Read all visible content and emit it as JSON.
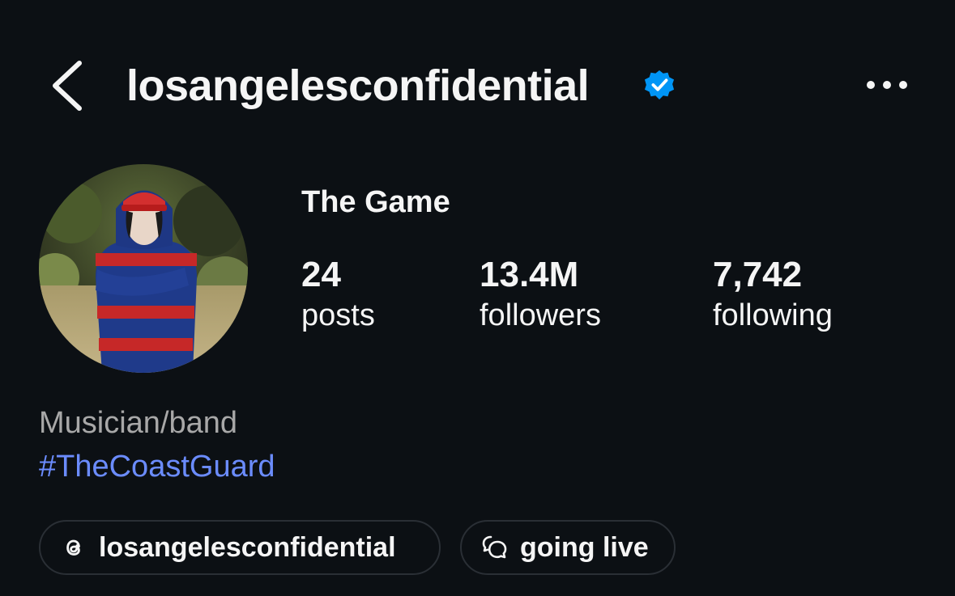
{
  "header": {
    "username": "losangelesconfidential",
    "verified": true,
    "back_icon": "chevron-left-icon",
    "more_icon": "more-horizontal-icon"
  },
  "profile": {
    "display_name": "The Game",
    "avatar": "profile-photo",
    "stats": [
      {
        "value": "24",
        "label": "posts"
      },
      {
        "value": "13.4M",
        "label": "followers"
      },
      {
        "value": "7,742",
        "label": "following"
      }
    ],
    "category": "Musician/band",
    "hashtag": "#TheCoastGuard"
  },
  "chips": {
    "threads": {
      "icon": "threads-icon",
      "label": "losangelesconfidential"
    },
    "live": {
      "icon": "chat-bubbles-icon",
      "label": "going live"
    }
  },
  "colors": {
    "background": "#0c1014",
    "text": "#f5f5f5",
    "muted": "#a8a8a8",
    "link": "#6b8cff",
    "verified": "#0095f6",
    "chip_border": "#2a2f35"
  }
}
